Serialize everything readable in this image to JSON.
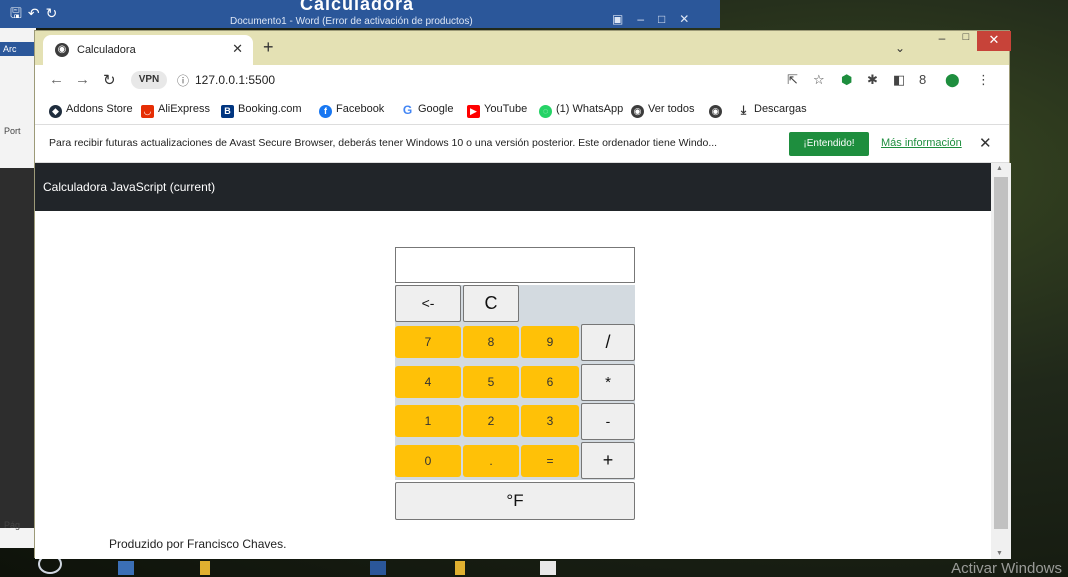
{
  "background": {
    "word_title": "Documento1 - Word (Error de activación de productos)",
    "word_left_labels": [
      "Arc",
      "Port",
      "Pág"
    ],
    "overlay_title": "Calculadora",
    "activate_windows": "Activar Windows"
  },
  "browser": {
    "tab": {
      "title": "Calculadora",
      "favicon": "globe-icon"
    },
    "url": "127.0.0.1:5500",
    "vpn_label": "VPN",
    "bookmarks": [
      {
        "label": "Addons Store",
        "icon": "addons-icon",
        "color": "#1f2d3d"
      },
      {
        "label": "AliExpress",
        "icon": "aliexpress-icon",
        "color": "#e62e04"
      },
      {
        "label": "Booking.com",
        "icon": "booking-icon",
        "color": "#003580"
      },
      {
        "label": "Facebook",
        "icon": "facebook-icon",
        "color": "#1877f2"
      },
      {
        "label": "Google",
        "icon": "google-icon",
        "color": "#4285f4"
      },
      {
        "label": "YouTube",
        "icon": "youtube-icon",
        "color": "#ff0000"
      },
      {
        "label": "(1) WhatsApp",
        "icon": "whatsapp-icon",
        "color": "#25d366"
      },
      {
        "label": "Ver todos",
        "icon": "globe-icon",
        "color": "#3c3c3c"
      },
      {
        "label": "",
        "icon": "globe-icon",
        "color": "#3c3c3c"
      },
      {
        "label": "Descargas",
        "icon": "download-icon",
        "color": "#ffffff"
      }
    ],
    "infobar": {
      "message": "Para recibir futuras actualizaciones de Avast Secure Browser, deberás tener Windows 10 o una versión posterior. Este ordenador tiene Windo...",
      "ok_button": "¡Entendido!",
      "more_link": "Más información"
    }
  },
  "page": {
    "navbar_brand": "Calculadora JavaScript (current)",
    "calculator": {
      "display_value": "",
      "backspace_label": "<-",
      "clear_label": "C",
      "rows": [
        [
          "7",
          "8",
          "9",
          "/"
        ],
        [
          "4",
          "5",
          "6",
          "*"
        ],
        [
          "1",
          "2",
          "3",
          "-"
        ],
        [
          "0",
          ".",
          "=",
          "+"
        ]
      ],
      "fahrenheit_label": "°F"
    },
    "footer": "Produzido por Francisco Chaves."
  },
  "colors": {
    "number_key": "#ffc107",
    "navbar": "#212529",
    "accept_button": "#1e8e3e"
  }
}
